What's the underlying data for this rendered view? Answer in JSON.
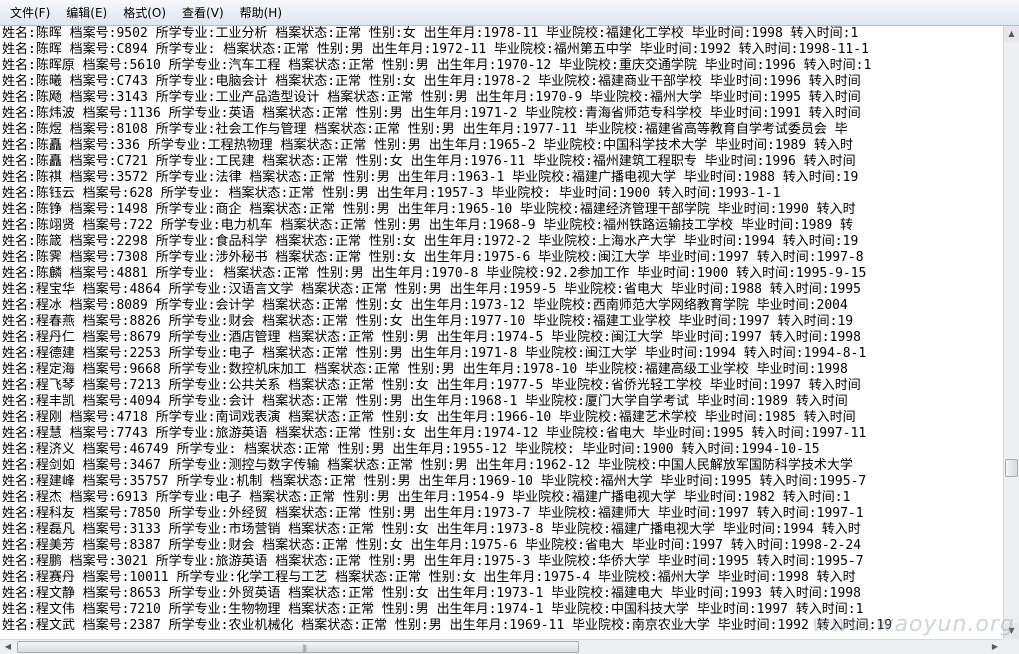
{
  "menu": [
    "文件(F)",
    "编辑(E)",
    "格式(O)",
    "查看(V)",
    "帮助(H)"
  ],
  "lines": [
    "姓名:陈晖 档案号:9502 所学专业:工业分析 档案状态:正常 性别:女 出生年月:1978-11 毕业院校:福建化工学校 毕业时间:1998 转入时间:1",
    "姓名:陈晖 档案号:C894 所学专业: 档案状态:正常 性别:男 出生年月:1972-11 毕业院校:福州第五中学 毕业时间:1992 转入时间:1998-11-1",
    "姓名:陈晖原 档案号:5610 所学专业:汽车工程 档案状态:正常 性别:男 出生年月:1970-12 毕业院校:重庆交通学院 毕业时间:1996 转入时间:1",
    "姓名:陈曦 档案号:C743 所学专业:电脑会计 档案状态:正常 性别:女 出生年月:1978-2 毕业院校:福建商业干部学校 毕业时间:1996 转入时间",
    "姓名:陈飏 档案号:3143 所学专业:工业产品造型设计 档案状态:正常 性别:男 出生年月:1970-9 毕业院校:福州大学 毕业时间:1995 转入时间",
    "姓名:陈炜波 档案号:1136 所学专业:英语 档案状态:正常 性别:男 出生年月:1971-2 毕业院校:青海省师范专科学校 毕业时间:1991 转入时间",
    "姓名:陈煜 档案号:8108 所学专业:社会工作与管理 档案状态:正常 性别:男 出生年月:1977-11 毕业院校:福建省高等教育自学考试委员会 毕",
    "姓名:陈矗 档案号:336 所学专业:工程热物理 档案状态:正常 性别:男 出生年月:1965-2 毕业院校:中国科学技术大学 毕业时间:1989 转入时",
    "姓名:陈矗 档案号:C721 所学专业:工民建 档案状态:正常 性别:女 出生年月:1976-11 毕业院校:福州建筑工程职专 毕业时间:1996 转入时间",
    "姓名:陈祺 档案号:3572 所学专业:法律 档案状态:正常 性别:男 出生年月:1963-1 毕业院校:福建广播电视大学 毕业时间:1988 转入时间:19",
    "姓名:陈钰云 档案号:628 所学专业: 档案状态:正常 性别:男 出生年月:1957-3 毕业院校: 毕业时间:1900 转入时间:1993-1-1",
    "姓名:陈铮 档案号:1498 所学专业:商企 档案状态:正常 性别:男 出生年月:1965-10 毕业院校:福建经济管理干部学院 毕业时间:1990 转入时",
    "姓名:陈翊贤 档案号:722 所学专业:电力机车 档案状态:正常 性别:男 出生年月:1968-9 毕业院校:福州铁路运输技工学校 毕业时间:1989 转",
    "姓名:陈箴 档案号:2298 所学专业:食品科学 档案状态:正常 性别:女 出生年月:1972-2 毕业院校:上海水产大学 毕业时间:1994 转入时间:19",
    "姓名:陈霁 档案号:7308 所学专业:涉外秘书 档案状态:正常 性别:女 出生年月:1975-6 毕业院校:闽江大学 毕业时间:1997 转入时间:1997-8",
    "姓名:陈麟 档案号:4881 所学专业: 档案状态:正常 性别:男 出生年月:1970-8 毕业院校:92.2参加工作 毕业时间:1900 转入时间:1995-9-15",
    "姓名:程宝华 档案号:4864 所学专业:汉语言文学 档案状态:正常 性别:男 出生年月:1959-5 毕业院校:省电大 毕业时间:1988 转入时间:1995",
    "姓名:程冰 档案号:8089 所学专业:会计学 档案状态:正常 性别:女 出生年月:1973-12 毕业院校:西南师范大学网络教育学院 毕业时间:2004",
    "姓名:程春燕 档案号:8826 所学专业:财会 档案状态:正常 性别:女 出生年月:1977-10 毕业院校:福建工业学校 毕业时间:1997 转入时间:19",
    "姓名:程丹仁 档案号:8679 所学专业:酒店管理 档案状态:正常 性别:男 出生年月:1974-5 毕业院校:闽江大学 毕业时间:1997 转入时间:1998",
    "姓名:程德建 档案号:2253 所学专业:电子 档案状态:正常 性别:男 出生年月:1971-8 毕业院校:闽江大学 毕业时间:1994 转入时间:1994-8-1",
    "姓名:程定海 档案号:9668 所学专业:数控机床加工 档案状态:正常 性别:男 出生年月:1978-10 毕业院校:福建高级工业学校 毕业时间:1998",
    "姓名:程飞琴 档案号:7213 所学专业:公共关系 档案状态:正常 性别:女 出生年月:1977-5 毕业院校:省侨光轻工学校 毕业时间:1997 转入时间",
    "姓名:程丰凯 档案号:4094 所学专业:会计 档案状态:正常 性别:男 出生年月:1968-1 毕业院校:厦门大学自学考试 毕业时间:1989 转入时间",
    "姓名:程刚 档案号:4718 所学专业:南词戏表演 档案状态:正常 性别:女 出生年月:1966-10 毕业院校:福建艺术学校 毕业时间:1985 转入时间",
    "姓名:程慧 档案号:7743 所学专业:旅游英语 档案状态:正常 性别:女 出生年月:1974-12 毕业院校:省电大 毕业时间:1995 转入时间:1997-11",
    "姓名:程济义 档案号:46749 所学专业: 档案状态:正常 性别:男 出生年月:1955-12 毕业院校: 毕业时间:1900 转入时间:1994-10-15",
    "姓名:程剑如 档案号:3467 所学专业:测控与数字传输 档案状态:正常 性别:男 出生年月:1962-12 毕业院校:中国人民解放军国防科学技术大学",
    "姓名:程建峰 档案号:35757 所学专业:机制 档案状态:正常 性别:男 出生年月:1969-10 毕业院校:福州大学 毕业时间:1995 转入时间:1995-7",
    "姓名:程杰 档案号:6913 所学专业:电子 档案状态:正常 性别:男 出生年月:1954-9 毕业院校:福建广播电视大学 毕业时间:1982 转入时间:1",
    "姓名:程科友 档案号:7850 所学专业:外经贸 档案状态:正常 性别:男 出生年月:1973-7 毕业院校:福建师大 毕业时间:1997 转入时间:1997-1",
    "姓名:程磊凡 档案号:3133 所学专业:市场营销 档案状态:正常 性别:女 出生年月:1973-8 毕业院校:福建广播电视大学 毕业时间:1994 转入时",
    "姓名:程美芳 档案号:8387 所学专业:财会 档案状态:正常 性别:女 出生年月:1975-6 毕业院校:省电大 毕业时间:1997 转入时间:1998-2-24",
    "姓名:程鹏 档案号:3021 所学专业:旅游英语 档案状态:正常 性别:男 出生年月:1975-3 毕业院校:华侨大学 毕业时间:1995 转入时间:1995-7",
    "姓名:程赛丹 档案号:10011 所学专业:化学工程与工艺 档案状态:正常 性别:女 出生年月:1975-4 毕业院校:福州大学 毕业时间:1998 转入时",
    "姓名:程文静 档案号:8653 所学专业:外贸英语 档案状态:正常 性别:女 出生年月:1973-1 毕业院校:福建电大 毕业时间:1993 转入时间:1998",
    "姓名:程文伟 档案号:7210 所学专业:生物物理 档案状态:正常 性别:男 出生年月:1974-1 毕业院校:中国科技大学 毕业时间:1997 转入时间:1",
    "姓名:程文武 档案号:2387 所学专业:农业机械化 档案状态:正常 性别:男 出生年月:1969-11 毕业院校:南京农业大学 毕业时间:1992 转入时间:19"
  ],
  "watermark": "www.waoyun.org",
  "vscroll_position": 0.74,
  "hscroll_visible_fraction": 0.58
}
